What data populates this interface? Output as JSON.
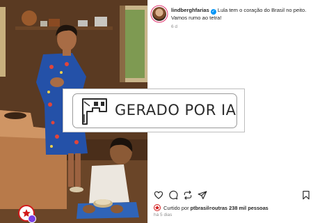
{
  "post": {
    "username": "lindberghfarias",
    "caption": "Lula tem o coração do Brasil no peito. Vamos rumo ao tetra!",
    "time_ago": "6 d"
  },
  "ai_label": {
    "text": "GERADO POR IA",
    "icon": "robot-icon"
  },
  "likes": {
    "prefix": "Curtido por ",
    "user": "ptbrasil",
    "connector": " e ",
    "others": "outras 238 mil pessoas"
  },
  "date": "há 5 dias",
  "colors": {
    "verified": "#0095f6",
    "muted": "#8e8e8e",
    "ai_badge": "#7b3fe4",
    "party_red": "#d21a1a"
  },
  "icons": [
    "heart-icon",
    "comment-icon",
    "repost-icon",
    "share-icon",
    "bookmark-icon",
    "verified-icon",
    "star-icon"
  ]
}
